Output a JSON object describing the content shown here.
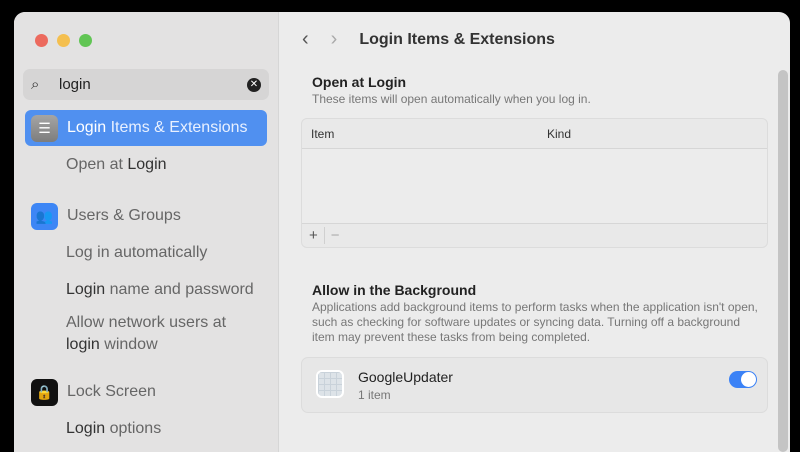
{
  "window": {
    "traffic_lights": {
      "close": "#ec6a5e",
      "minimize": "#f4bf4f",
      "zoom": "#61c554"
    }
  },
  "sidebar": {
    "search": {
      "value": "login",
      "icon": "magnifier-icon",
      "clear_icon": "clear-icon"
    },
    "items": [
      {
        "highlight": "Login",
        "rest": " Items & Extensions",
        "icon": "list-icon",
        "selected": true
      },
      {
        "highlight": "",
        "rest": "Users & Groups",
        "icon": "users-icon"
      },
      {
        "highlight": "",
        "rest": "Lock Screen",
        "icon": "lock-icon"
      }
    ],
    "subitems": [
      {
        "pre": "Open at ",
        "highlight": "Login",
        "rest": ""
      },
      {
        "pre": "Log in automatically",
        "highlight": "",
        "rest": ""
      },
      {
        "pre": "",
        "highlight": "Login",
        "rest": " name and password"
      },
      {
        "pre": "Allow network users at",
        "highlight": "",
        "rest": ""
      },
      {
        "pre": "",
        "highlight": "login",
        "rest": " window"
      },
      {
        "pre": "",
        "highlight": "Login",
        "rest": " options"
      }
    ]
  },
  "main": {
    "nav": {
      "back": "‹",
      "forward": "›",
      "title": "Login Items & Extensions"
    },
    "open_at_login": {
      "heading": "Open at Login",
      "description": "These items will open automatically when you log in.",
      "columns": [
        "Item",
        "Kind"
      ],
      "add": "+",
      "remove": "−"
    },
    "background": {
      "heading": "Allow in the Background",
      "description": "Applications add background items to perform tasks when the application isn't open, such as checking for software updates or syncing data. Turning off a background item may prevent these tasks from being completed.",
      "items": [
        {
          "name": "GoogleUpdater",
          "detail": "1 item",
          "enabled": true
        }
      ]
    },
    "accent": "#3b82f6"
  }
}
